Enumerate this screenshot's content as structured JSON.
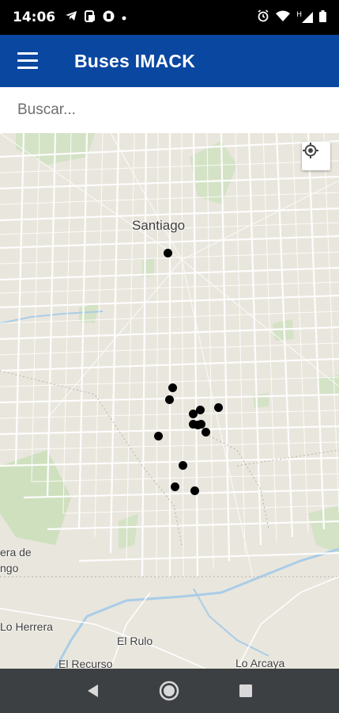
{
  "status_bar": {
    "time": "14:06",
    "left_icons": [
      "telegram-icon",
      "screencast-icon",
      "shield-icon",
      "dot-icon"
    ],
    "right_icons": [
      "alarm-icon",
      "wifi-icon",
      "signal-h-icon",
      "battery-icon"
    ],
    "signal_label": "H"
  },
  "app_bar": {
    "title": "Buses IMACK",
    "menu_icon": "hamburger-menu-icon",
    "background_color": "#0a47a1"
  },
  "search": {
    "placeholder": "Buscar...",
    "value": ""
  },
  "map": {
    "labels": {
      "santiago": "Santiago",
      "era_de_1": "era de",
      "era_de_2": "ngo",
      "lo_herrera": "Lo Herrera",
      "el_rulo": "El Rulo",
      "el_recurso": "El Recurso",
      "lo_arcaya": "Lo Arcaya"
    },
    "locate_button_icon": "my-location-icon",
    "bus_marker_color": "#000000",
    "bus_marker_count": 16
  },
  "nav_bar": {
    "back_icon": "back-triangle-icon",
    "home_icon": "home-circle-icon",
    "recents_icon": "recents-square-icon"
  }
}
